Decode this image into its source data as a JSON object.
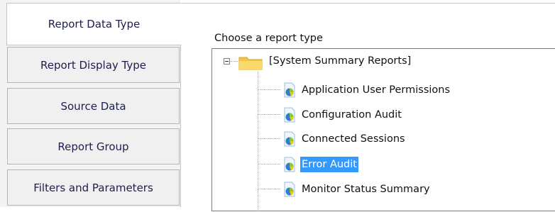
{
  "tabs": [
    {
      "label": "Report Data Type",
      "active": true
    },
    {
      "label": "Report Display Type",
      "active": false
    },
    {
      "label": "Source Data",
      "active": false
    },
    {
      "label": "Report Group",
      "active": false
    },
    {
      "label": "Filters and Parameters",
      "active": false
    }
  ],
  "panel": {
    "label": "Choose a report type"
  },
  "tree": {
    "root": {
      "label": "[System Summary Reports]",
      "expanded": true,
      "icon": "folder-icon"
    },
    "items": [
      {
        "label": "Application User Permissions",
        "icon": "report-icon",
        "selected": false
      },
      {
        "label": "Configuration Audit",
        "icon": "report-icon",
        "selected": false
      },
      {
        "label": "Connected Sessions",
        "icon": "report-icon",
        "selected": false
      },
      {
        "label": "Error Audit",
        "icon": "report-icon",
        "selected": true
      },
      {
        "label": "Monitor Status Summary",
        "icon": "report-icon",
        "selected": false
      }
    ]
  },
  "colors": {
    "selection": "#3399ff",
    "tab_text": "#1e1e50",
    "tab_bg": "#f0f0f0"
  }
}
